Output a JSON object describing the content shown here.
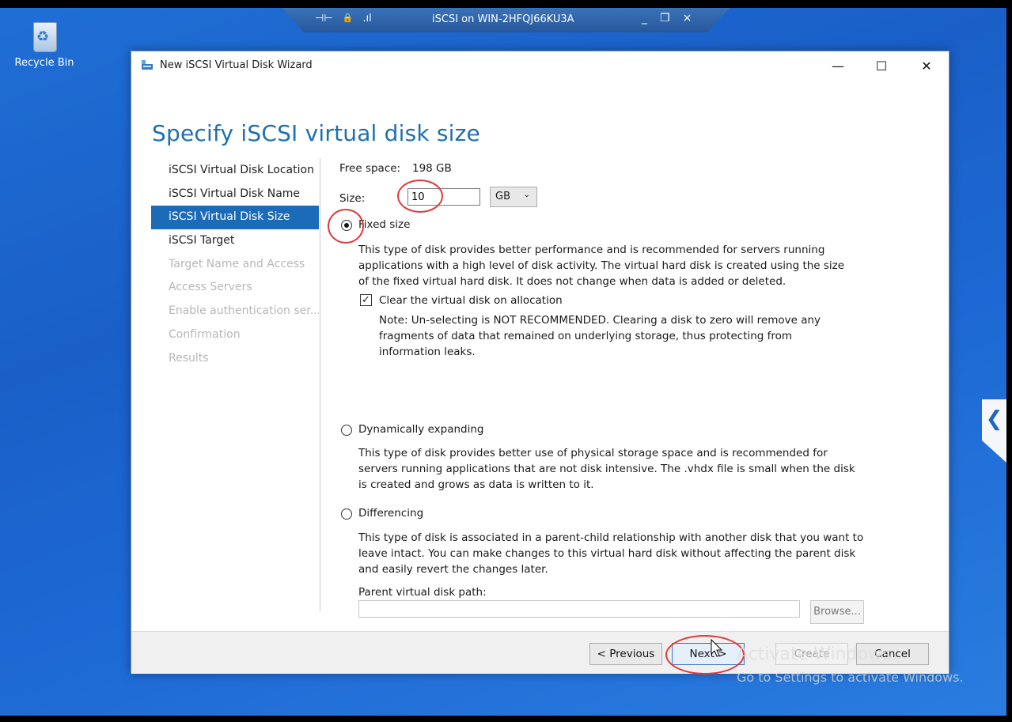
{
  "rdp_bar": {
    "title": "iSCSI on WIN-2HFQJ66KU3A",
    "pin": "⊣⊢",
    "lock": "🔒",
    "signal": ".ıl",
    "minimize": "_",
    "restore": "❐",
    "close": "×"
  },
  "desktop": {
    "recycle_bin_label": "Recycle Bin",
    "watermark_line1": "Activate Windows",
    "watermark_line2": "Go to Settings to activate Windows.",
    "side_tab_glyph": "❮"
  },
  "window": {
    "title": "New iSCSI Virtual Disk Wizard",
    "minimize": "—",
    "maximize": "☐",
    "close": "✕",
    "heading": "Specify iSCSI virtual disk size"
  },
  "nav": {
    "items": [
      {
        "label": "iSCSI Virtual Disk Location",
        "state": "normal"
      },
      {
        "label": "iSCSI Virtual Disk Name",
        "state": "normal"
      },
      {
        "label": "iSCSI Virtual Disk Size",
        "state": "active"
      },
      {
        "label": "iSCSI Target",
        "state": "normal"
      },
      {
        "label": "Target Name and Access",
        "state": "disabled"
      },
      {
        "label": "Access Servers",
        "state": "disabled"
      },
      {
        "label": "Enable authentication ser...",
        "state": "disabled"
      },
      {
        "label": "Confirmation",
        "state": "disabled"
      },
      {
        "label": "Results",
        "state": "disabled"
      }
    ]
  },
  "form": {
    "free_space_label": "Free space:",
    "free_space_value": "198 GB",
    "size_label": "Size:",
    "size_value": "10",
    "unit": "GB",
    "unit_chevron": "⌄",
    "fixed": {
      "label": "Fixed size",
      "selected": true,
      "description": "This type of disk provides better performance and is recommended for servers running applications with a high level of disk activity. The virtual hard disk is created using the size of the fixed virtual hard disk. It does not change when data is added or deleted.",
      "clear_label": "Clear the virtual disk on allocation",
      "clear_checked": "✓",
      "note": "Note: Un-selecting is NOT RECOMMENDED. Clearing a disk to zero will remove any fragments of data that remained on underlying storage, thus protecting from information leaks."
    },
    "dynamic": {
      "label": "Dynamically expanding",
      "description": "This type of disk provides better use of physical storage space and is recommended for servers running applications that are not disk intensive. The .vhdx file is small when the disk is created and grows as data is written to it."
    },
    "differencing": {
      "label": "Differencing",
      "description": "This type of disk is associated in a parent-child relationship with another disk that you want to leave intact. You can make changes to this virtual hard disk without affecting the parent disk and easily revert the changes later.",
      "parent_path_label": "Parent virtual disk path:",
      "parent_path_value": "",
      "browse_label": "Browse..."
    }
  },
  "footer": {
    "previous": "< Previous",
    "next": "Next >",
    "create": "Create",
    "cancel": "Cancel"
  },
  "colors": {
    "accent": "#1c6bb9",
    "heading": "#1e6fb5",
    "annotation": "#e03a3a",
    "desktop": "#1f6fd6"
  }
}
